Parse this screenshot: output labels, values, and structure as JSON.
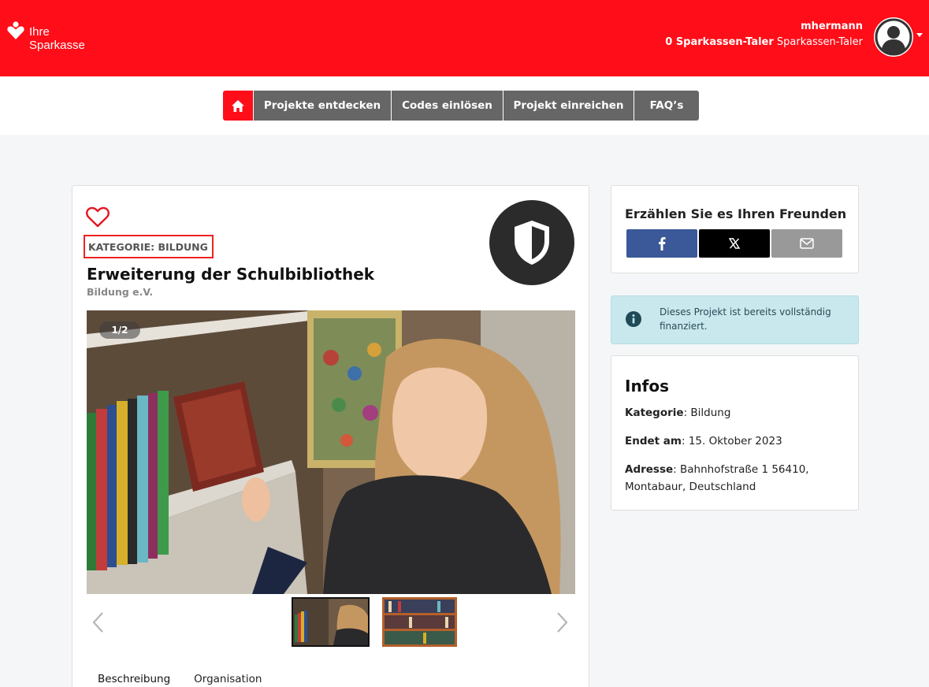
{
  "header": {
    "logo_line1": "Ihre",
    "logo_line2": "Sparkasse",
    "username": "mhermann",
    "taler_amount": "0 Sparkassen-Taler",
    "taler_unit": "Sparkassen-Taler"
  },
  "nav": {
    "items": [
      "Projekte entdecken",
      "Codes einlösen",
      "Projekt einreichen",
      "FAQ’s"
    ]
  },
  "project": {
    "category": "KATEGORIE: BILDUNG",
    "title": "Erweiterung der Schulbibliothek",
    "organisation": "Bildung e.V.",
    "image_counter": "1/2"
  },
  "tabs": [
    "Beschreibung",
    "Organisation"
  ],
  "share": {
    "title": "Erzählen Sie es Ihren Freunden"
  },
  "alert": {
    "text": "Dieses Projekt ist bereits vollständig finanziert."
  },
  "infos": {
    "title": "Infos",
    "category_label": "Kategorie",
    "category_value": ": Bildung",
    "end_label": "Endet am",
    "end_value": ": 15. Oktober 2023",
    "address_label": "Adresse",
    "address_value": ": Bahnhofstraße 1 56410, Montabaur, Deutschland"
  },
  "colors": {
    "brand_red": "#ff0d18",
    "nav_gray": "#666666",
    "facebook": "#3b5998",
    "x": "#000000",
    "mail": "#999999",
    "alert_bg": "#c8e8ee"
  }
}
